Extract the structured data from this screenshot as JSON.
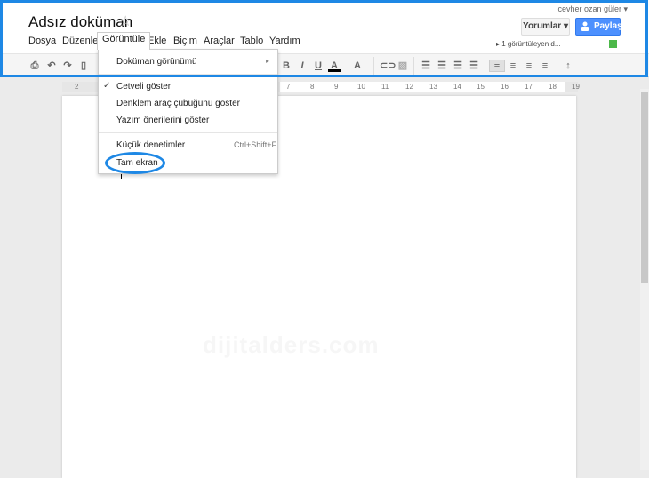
{
  "header": {
    "title": "Adsız doküman",
    "star_icon": "star-icon",
    "user": "cevher ozan güler ▾",
    "comments_button": "Yorumlar ▾",
    "share_button": "Paylaş",
    "viewers": "1 görüntüleyen d...",
    "viewer_color": "#4cb849",
    "accent": "#4d90fe"
  },
  "menu": [
    "Dosya",
    "Düzenle",
    "Görüntüle",
    "Ekle",
    "Biçim",
    "Araçlar",
    "Tablo",
    "Yardım"
  ],
  "toolbar": {
    "bold": "B",
    "italic": "I",
    "underline": "U",
    "text_color": "A",
    "highlight": "A"
  },
  "ruler": [
    "2",
    "7",
    "8",
    "9",
    "10",
    "11",
    "12",
    "13",
    "14",
    "15",
    "16",
    "17",
    "18",
    "19"
  ],
  "dropdown": {
    "items": [
      {
        "label": "Doküman görünümü",
        "submenu": "▸"
      },
      {
        "label": "Cetveli göster",
        "check": "✓"
      },
      {
        "label": "Denklem araç çubuğunu göster"
      },
      {
        "label": "Yazım önerilerini göster"
      },
      {
        "label": "Küçük denetimler",
        "shortcut": "Ctrl+Shift+F"
      },
      {
        "label": "Tam ekran"
      }
    ]
  },
  "watermark": "dijitalders.com",
  "highlight_color": "#1e88e5"
}
